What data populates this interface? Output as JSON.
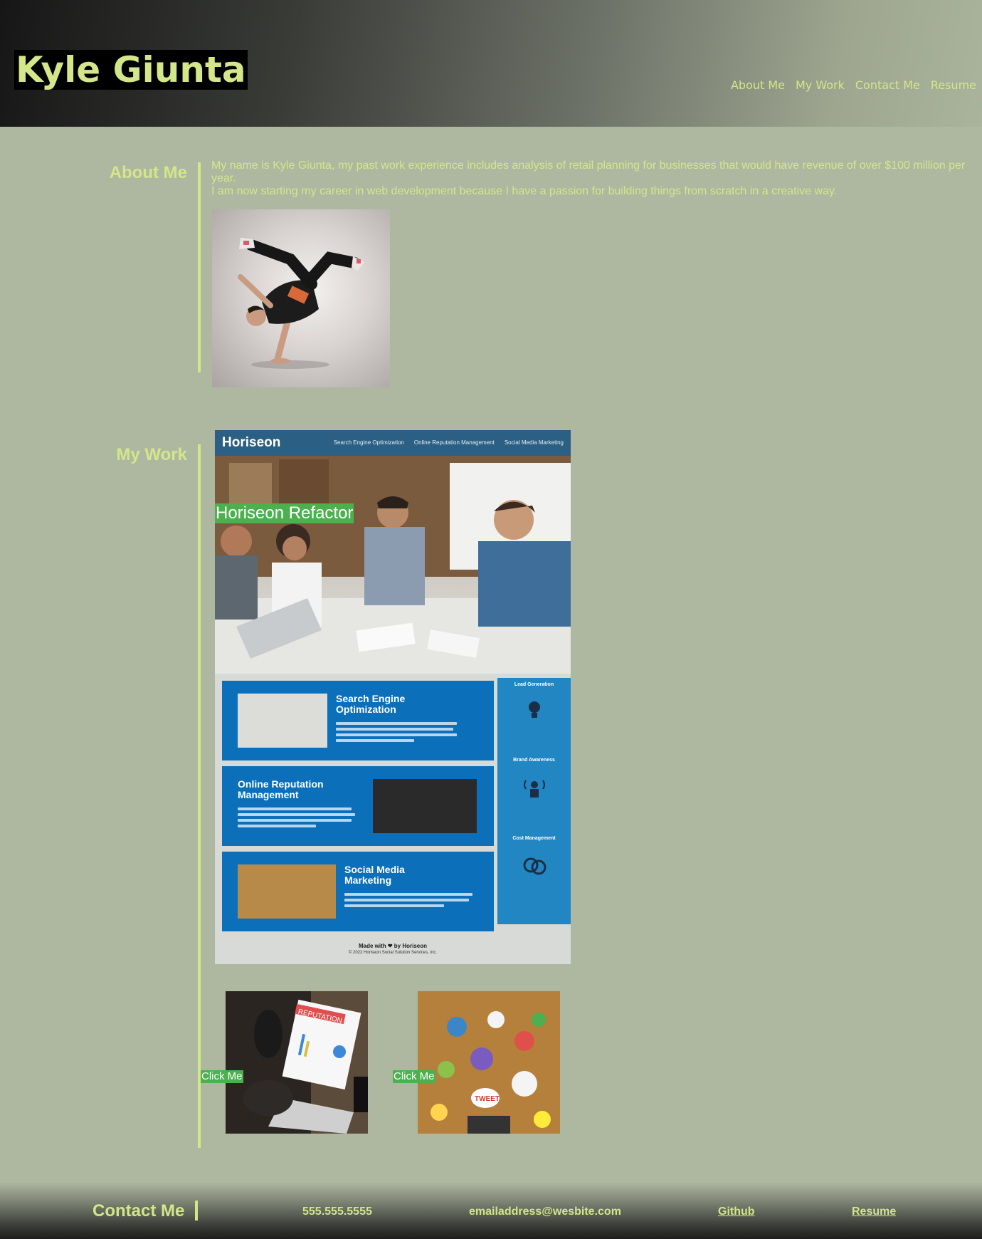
{
  "header": {
    "title": "Kyle Giunta",
    "nav": [
      "About Me",
      "My Work",
      "Contact Me",
      "Resume"
    ]
  },
  "about": {
    "heading": "About Me",
    "paragraph1": "My name is Kyle Giunta, my past work experience includes analysis of retail planning for businesses that would have revenue of over $100 million per year.",
    "paragraph2": "I am now starting my career in web development because I have a passion for building things from scratch in a creative way.",
    "photo_alt": "breakdancer"
  },
  "work": {
    "heading": "My Work",
    "featured": {
      "label": "Horiseon Refactor",
      "screenshot": {
        "logo": "Horiseon",
        "nav": [
          "Search Engine Optimization",
          "Online Reputation Management",
          "Social Media Marketing"
        ],
        "cards": [
          "Search Engine Optimization",
          "Online Reputation Management",
          "Social Media Marketing"
        ],
        "sidebar": [
          "Lead Generation",
          "Brand Awareness",
          "Cost Management"
        ],
        "footer": "Made with ❤ by Horiseon",
        "copyright": "© 2022 Horiseon Social Solution Services, Inc."
      }
    },
    "thumbnails": [
      {
        "button": "Click Me",
        "image_text": "REPUTATION"
      },
      {
        "button": "Click Me",
        "image_text": "TWEET"
      }
    ]
  },
  "footer": {
    "heading": "Contact Me",
    "phone": "555.555.5555",
    "email": "emailaddress@wesbite.com",
    "github": "Github",
    "resume": "Resume"
  },
  "colors": {
    "accent": "#d4e68a",
    "background": "#aeb8a1",
    "label_green": "#4cb04f",
    "horiseon_blue": "#0b6fba"
  }
}
